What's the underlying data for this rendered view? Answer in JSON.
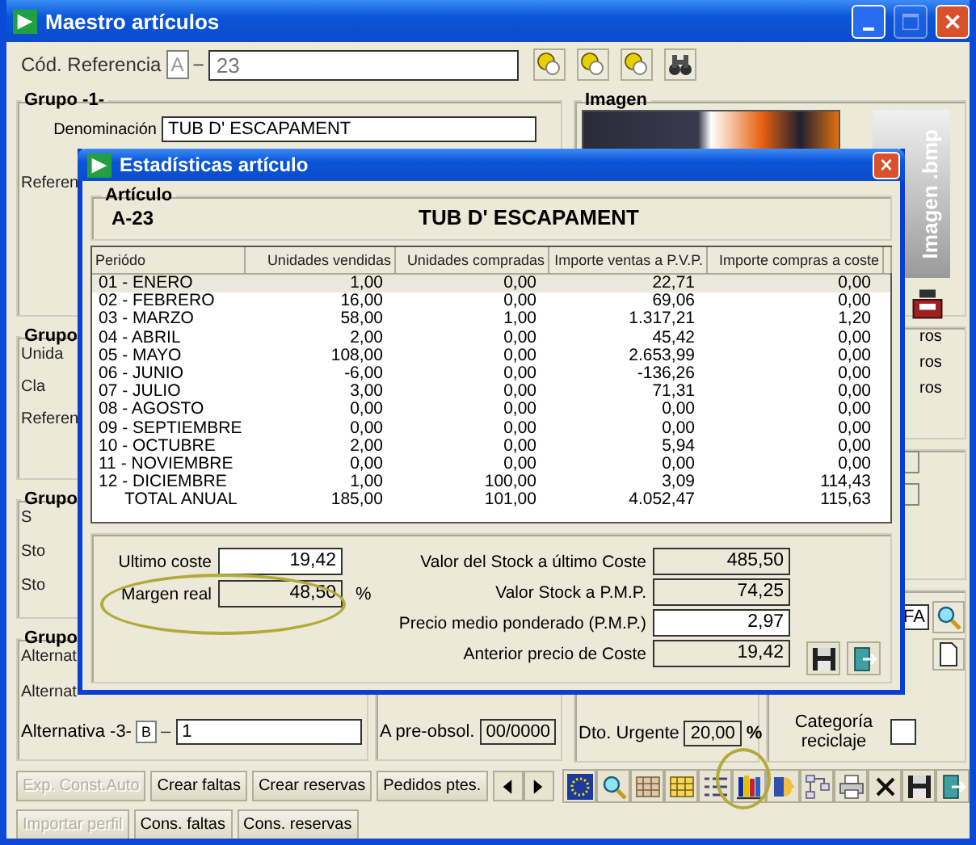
{
  "window": {
    "title": "Maestro artículos"
  },
  "window_buttons": [
    {
      "kind": "minimize",
      "disabled": false
    },
    {
      "kind": "maximize",
      "disabled": true
    },
    {
      "kind": "close",
      "disabled": false
    }
  ],
  "reference": {
    "label": "Cód. Referencia",
    "series": "A",
    "separator": "–",
    "value": "23"
  },
  "reference_tools": [
    {
      "kind": "search"
    },
    {
      "kind": "search"
    },
    {
      "kind": "search"
    },
    {
      "kind": "binoculars"
    }
  ],
  "group_1": {
    "title": "Grupo -1-",
    "denomination_label": "Denominación",
    "denomination": "TUB D' ESCAPAMENT",
    "cut_labels": [
      "Referen"
    ]
  },
  "group_2": {
    "title": "Grupo",
    "cut_labels": [
      "Unida",
      "Cla",
      "Referen"
    ]
  },
  "group_3": {
    "title": "Grupo",
    "cut_labels": [
      "S",
      "Sto",
      "Sto"
    ]
  },
  "group_4": {
    "title": "Grupo",
    "cut_labels": [
      "Alternat",
      "Alternat"
    ],
    "alternative_3": {
      "label": "Alternativa -3-",
      "series": "B",
      "separator": "–",
      "value": "1"
    }
  },
  "obsolescence": {
    "label": "A pre-obsol.",
    "value": "00/0000"
  },
  "image": {
    "title": "Imagen",
    "file_label": "Imagen .bmp"
  },
  "right_group_2": {
    "cut_labels": [
      "ros",
      "ros",
      "ros"
    ]
  },
  "discount": {
    "label": "Dto. Urgente",
    "value": "20,00",
    "unit": "%"
  },
  "category": {
    "code": "FA",
    "label": "Categoría reciclaje",
    "checked": false
  },
  "buttons_row_1": [
    {
      "label": "Exp. Const.Auto",
      "disabled": true
    },
    {
      "label": "Crear faltas",
      "disabled": false
    },
    {
      "label": "Crear reservas",
      "disabled": false
    },
    {
      "label": "Pedidos ptes.",
      "disabled": false
    }
  ],
  "nav_buttons": [
    {
      "kind": "left"
    },
    {
      "kind": "right"
    }
  ],
  "tool_icons": [
    {
      "kind": "flag"
    },
    {
      "kind": "magnifier"
    },
    {
      "kind": "grid"
    },
    {
      "kind": "grid2"
    },
    {
      "kind": "list"
    },
    {
      "kind": "books"
    },
    {
      "kind": "faces"
    },
    {
      "kind": "network"
    },
    {
      "kind": "printer"
    },
    {
      "kind": "cross"
    },
    {
      "kind": "save"
    },
    {
      "kind": "exit"
    }
  ],
  "buttons_row_2": [
    {
      "label": "Importar perfil",
      "disabled": true
    },
    {
      "label": "Cons. faltas",
      "disabled": false
    },
    {
      "label": "Cons. reservas",
      "disabled": false
    }
  ],
  "dialog": {
    "title": "Estadísticas artículo",
    "article_label": "Artículo",
    "code": "A-23",
    "name": "TUB D' ESCAPAMENT",
    "table": {
      "columns": [
        "Periódo",
        "Unidades vendidas",
        "Unidades compradas",
        "Importe ventas a P.V.P.",
        "Importe compras a coste"
      ],
      "rows": [
        {
          "kind": "month",
          "cells": [
            "01 - ENERO",
            "1,00",
            "0,00",
            "22,71",
            "0,00"
          ],
          "selected": true
        },
        {
          "kind": "month",
          "cells": [
            "02 - FEBRERO",
            "16,00",
            "0,00",
            "69,06",
            "0,00"
          ],
          "selected": false
        },
        {
          "kind": "month",
          "cells": [
            "03 - MARZO",
            "58,00",
            "1,00",
            "1.317,21",
            "1,20"
          ],
          "selected": false
        },
        {
          "kind": "month",
          "cells": [
            "04 - ABRIL",
            "2,00",
            "0,00",
            "45,42",
            "0,00"
          ],
          "selected": false
        },
        {
          "kind": "month",
          "cells": [
            "05 - MAYO",
            "108,00",
            "0,00",
            "2.653,99",
            "0,00"
          ],
          "selected": false
        },
        {
          "kind": "month",
          "cells": [
            "06 - JUNIO",
            "-6,00",
            "0,00",
            "-136,26",
            "0,00"
          ],
          "selected": false
        },
        {
          "kind": "month",
          "cells": [
            "07 - JULIO",
            "3,00",
            "0,00",
            "71,31",
            "0,00"
          ],
          "selected": false
        },
        {
          "kind": "month",
          "cells": [
            "08 - AGOSTO",
            "0,00",
            "0,00",
            "0,00",
            "0,00"
          ],
          "selected": false
        },
        {
          "kind": "month",
          "cells": [
            "09 - SEPTIEMBRE",
            "0,00",
            "0,00",
            "0,00",
            "0,00"
          ],
          "selected": false
        },
        {
          "kind": "month",
          "cells": [
            "10 - OCTUBRE",
            "2,00",
            "0,00",
            "5,94",
            "0,00"
          ],
          "selected": false
        },
        {
          "kind": "month",
          "cells": [
            "11 - NOVIEMBRE",
            "0,00",
            "0,00",
            "0,00",
            "0,00"
          ],
          "selected": false
        },
        {
          "kind": "month",
          "cells": [
            "12 - DICIEMBRE",
            "1,00",
            "100,00",
            "3,09",
            "114,43"
          ],
          "selected": false
        },
        {
          "kind": "total",
          "cells": [
            "TOTAL ANUAL",
            "185,00",
            "101,00",
            "4.052,47",
            "115,63"
          ],
          "selected": false
        }
      ]
    },
    "left_fields": [
      {
        "label": "Ultimo coste",
        "value": "19,42",
        "editable": true
      },
      {
        "label": "Margen real",
        "value": "48,50",
        "editable": false,
        "unit": "%"
      }
    ],
    "right_fields": [
      {
        "label": "Valor del Stock a último Coste",
        "value": "485,50",
        "editable": false
      },
      {
        "label": "Valor Stock a P.M.P.",
        "value": "74,25",
        "editable": false
      },
      {
        "label": "Precio medio ponderado (P.M.P.)",
        "value": "2,97",
        "editable": true
      },
      {
        "label": "Anterior precio de Coste",
        "value": "19,42",
        "editable": false
      }
    ],
    "actions": [
      {
        "kind": "save"
      },
      {
        "kind": "exit"
      }
    ]
  }
}
